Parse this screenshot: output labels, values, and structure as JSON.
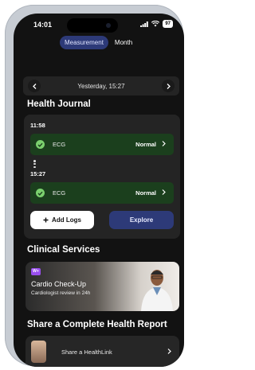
{
  "status_bar": {
    "time": "14:01",
    "battery": "97"
  },
  "segmented": {
    "items": [
      "Measurement",
      "Month"
    ],
    "active": "Measurement"
  },
  "date_nav": {
    "label": "Yesterday, 15:27"
  },
  "journal": {
    "title": "Health Journal",
    "entries": [
      {
        "time": "11:58",
        "type": "ECG",
        "status": "Normal"
      },
      {
        "time": "15:27",
        "type": "ECG",
        "status": "Normal"
      }
    ],
    "add_logs_label": "Add Logs",
    "explore_label": "Explore"
  },
  "clinical": {
    "title": "Clinical Services",
    "card": {
      "badge": "W+",
      "title": "Cardio Check-Up",
      "subtitle": "Cardiologist review in 24h"
    }
  },
  "report": {
    "title": "Share a Complete Health Report",
    "row_label": "Share a HealthLink"
  },
  "colors": {
    "background": "#121212",
    "card": "#242424",
    "accent": "#2d3a78",
    "ecg_bg": "#1b3f1d",
    "check": "#7bd06e"
  }
}
